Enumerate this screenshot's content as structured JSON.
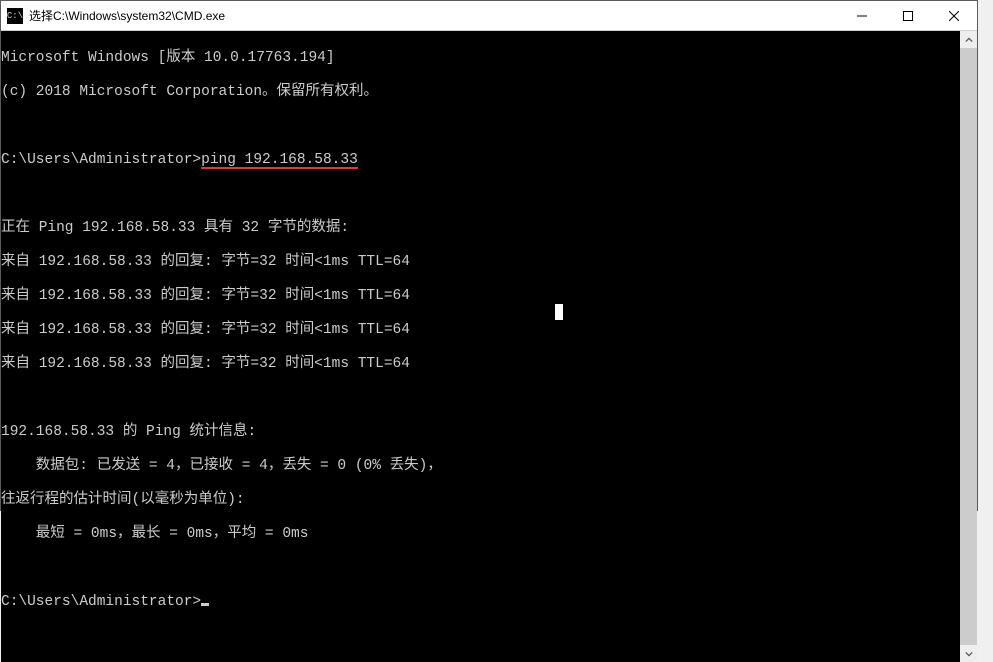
{
  "window": {
    "icon_label": "C:\\",
    "title": "选择C:\\Windows\\system32\\CMD.exe"
  },
  "terminal": {
    "banner1": "Microsoft Windows [版本 10.0.17763.194]",
    "banner2": "(c) 2018 Microsoft Corporation。保留所有权利。",
    "prompt1_prefix": "C:\\Users\\Administrator>",
    "prompt1_cmd": "ping 192.168.58.33",
    "ping_header": "正在 Ping 192.168.58.33 具有 32 字节的数据:",
    "reply1": "来自 192.168.58.33 的回复: 字节=32 时间<1ms TTL=64",
    "reply2": "来自 192.168.58.33 的回复: 字节=32 时间<1ms TTL=64",
    "reply3": "来自 192.168.58.33 的回复: 字节=32 时间<1ms TTL=64",
    "reply4": "来自 192.168.58.33 的回复: 字节=32 时间<1ms TTL=64",
    "stats_header": "192.168.58.33 的 Ping 统计信息:",
    "stats_packets": "    数据包: 已发送 = 4，已接收 = 4，丢失 = 0 (0% 丢失)，",
    "rtt_header": "往返行程的估计时间(以毫秒为单位):",
    "rtt_values": "    最短 = 0ms，最长 = 0ms，平均 = 0ms",
    "prompt2": "C:\\Users\\Administrator>"
  }
}
